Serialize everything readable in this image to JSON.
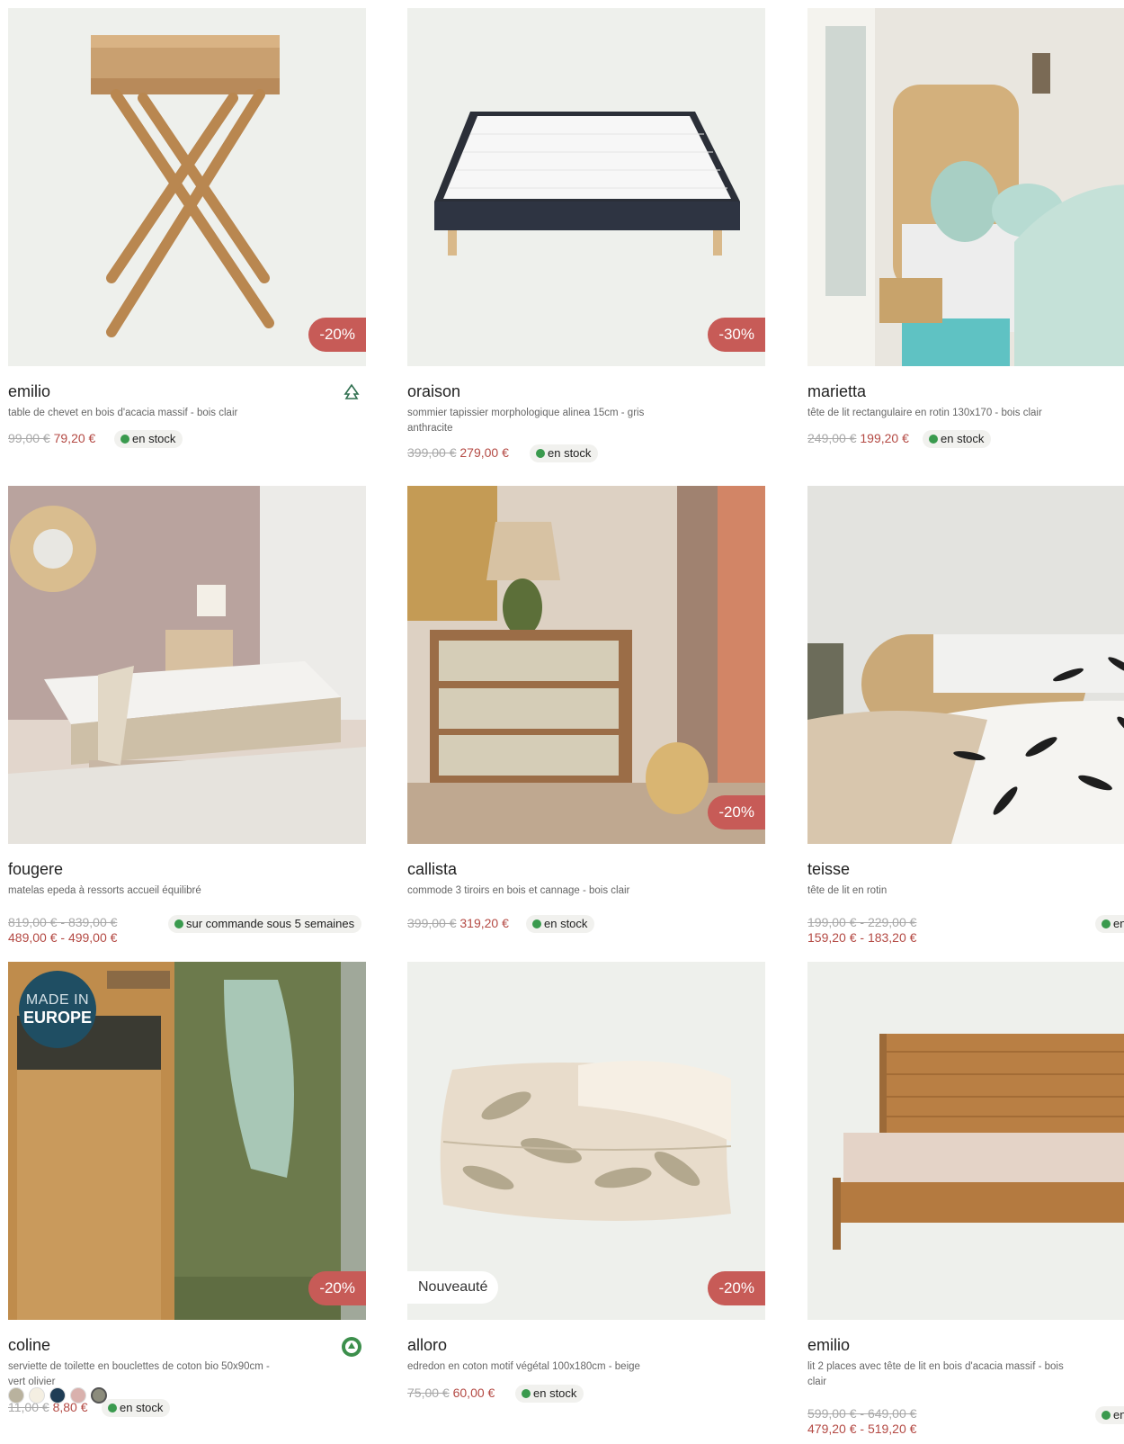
{
  "products": [
    {
      "name": "emilio",
      "desc": "table de chevet en bois d'acacia massif - bois clair",
      "old": "99,00 €",
      "new": "79,20 €",
      "stock": "en stock",
      "discount": "-20%"
    },
    {
      "name": "oraison",
      "desc": "sommier tapissier morphologique alinea 15cm - gris anthracite",
      "old": "399,00 €",
      "new": "279,00 €",
      "stock": "en stock",
      "discount": "-30%"
    },
    {
      "name": "marietta",
      "desc": "tête de lit rectangulaire en rotin 130x170 - bois clair",
      "old": "249,00 €",
      "new": "199,20 €",
      "stock": "en stock"
    },
    {
      "name": "fougere",
      "desc": "matelas epeda à ressorts accueil équilibré",
      "old": "819,00 € - 839,00 €",
      "new": "489,00 € - 499,00 €",
      "stock": "sur commande sous 5 semaines"
    },
    {
      "name": "callista",
      "desc": "commode 3 tiroirs en bois et cannage - bois clair",
      "old": "399,00 €",
      "new": "319,20 €",
      "stock": "en stock",
      "discount": "-20%"
    },
    {
      "name": "teisse",
      "desc": "tête de lit en rotin",
      "old": "199,00 € - 229,00 €",
      "new": "159,20 € - 183,20 €",
      "stock": "en"
    },
    {
      "name": "coline",
      "desc": "serviette de toilette en bouclettes de coton bio 50x90cm - vert olivier",
      "old": "11,00 €",
      "new": "8,80 €",
      "stock": "en stock",
      "discount": "-20%",
      "badge": {
        "line1": "MADE IN",
        "line2": "EUROPE"
      }
    },
    {
      "name": "alloro",
      "desc": "edredon en coton motif végétal 100x180cm - beige",
      "old": "75,00 €",
      "new": "60,00 €",
      "stock": "en stock",
      "discount": "-20%",
      "tag": "Nouveauté"
    },
    {
      "name": "emilio",
      "desc": "lit 2 places avec tête de lit en bois d'acacia massif - bois clair",
      "old": "599,00 € - 649,00 €",
      "new": "479,20 € - 519,20 €",
      "stock": "en"
    }
  ],
  "icons": {
    "fsc": "fsc-tree-icon",
    "organic": "organic-cotton-icon"
  },
  "swatch_colors": [
    "#b9b29e",
    "#f4efe2",
    "#1f3d55",
    "#d9b1ad",
    "#8c8c7c"
  ],
  "colors": {
    "accent": "#c75b57",
    "price": "#b44a44",
    "stock_dot": "#3a9a4e"
  }
}
